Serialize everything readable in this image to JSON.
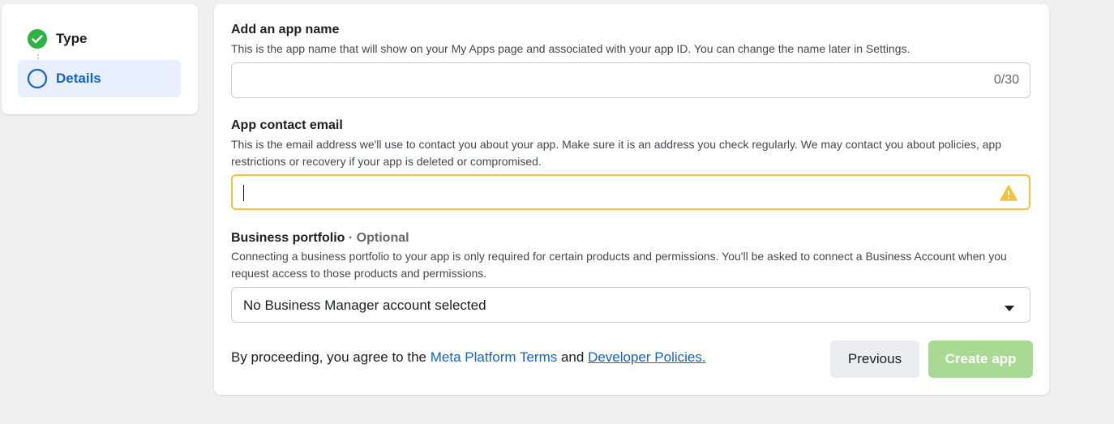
{
  "steps": [
    {
      "label": "Type",
      "status": "complete",
      "icon": "check-circle-icon"
    },
    {
      "label": "Details",
      "status": "current",
      "icon": "circle-outline-icon"
    }
  ],
  "app_name": {
    "title": "Add an app name",
    "description": "This is the app name that will show on your My Apps page and associated with your app ID. You can change the name later in Settings.",
    "value": "",
    "counter": "0/30"
  },
  "contact_email": {
    "title": "App contact email",
    "description": "This is the email address we'll use to contact you about your app. Make sure it is an address you check regularly. We may contact you about policies, app restrictions or recovery if your app is deleted or compromised.",
    "value": "",
    "status_icon": "warning-icon"
  },
  "business_portfolio": {
    "title": "Business portfolio",
    "optional_label": " · Optional",
    "description": "Connecting a business portfolio to your app is only required for certain products and permissions. You'll be asked to connect a Business Account when you request access to those products and permissions.",
    "selected": "No Business Manager account selected"
  },
  "footer": {
    "terms_prefix": "By proceeding, you agree to the ",
    "platform_terms_link": "Meta Platform Terms",
    "terms_and": " and ",
    "developer_policies_link": "Developer Policies.",
    "previous_label": "Previous",
    "create_label": "Create app"
  },
  "colors": {
    "accent": "#1463c6",
    "complete": "#2eb243",
    "warning": "#f5c33b",
    "create_disabled": "#a8da94"
  }
}
